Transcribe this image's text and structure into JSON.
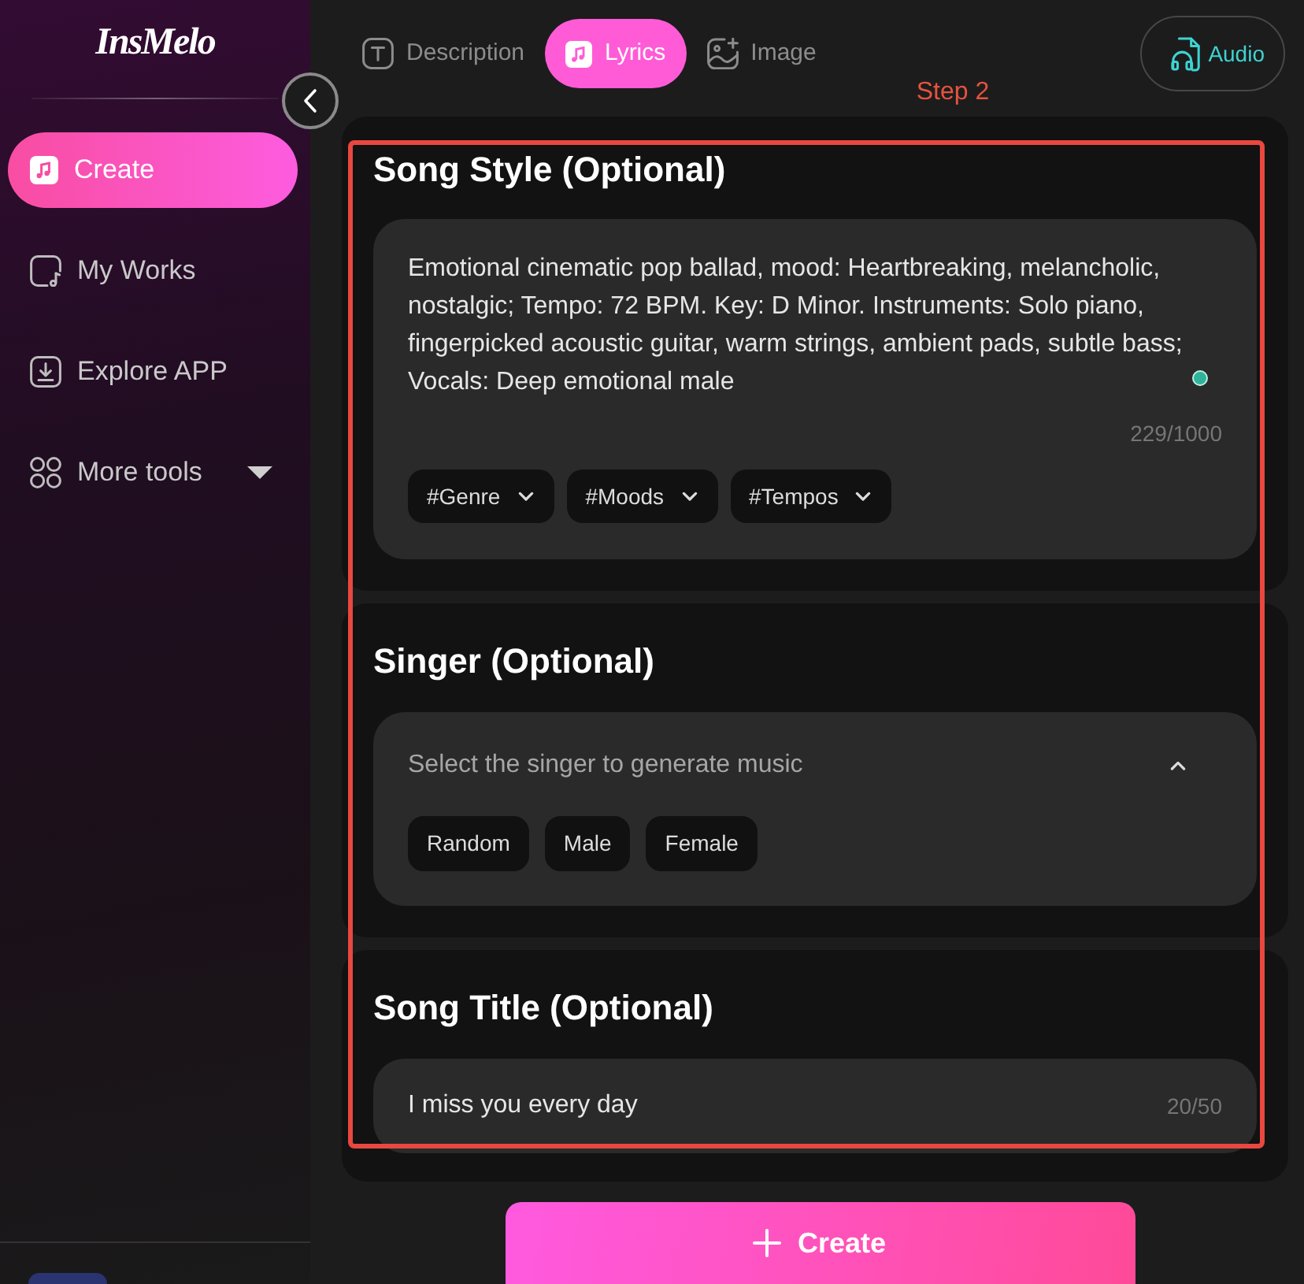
{
  "sidebar": {
    "logo": "InsMelo",
    "items": [
      {
        "label": "Create",
        "kind": "link",
        "selected": true
      },
      {
        "label": "My Works",
        "kind": "link",
        "selected": false
      },
      {
        "label": "Explore APP",
        "kind": "link",
        "selected": false
      },
      {
        "label": "More tools",
        "kind": "menu",
        "selected": false
      }
    ]
  },
  "tabs": [
    {
      "label": "Description",
      "selected": false
    },
    {
      "label": "Lyrics",
      "selected": true
    },
    {
      "label": "Image",
      "selected": false
    }
  ],
  "audio_button": "Audio",
  "annotation": {
    "label": "Step 2"
  },
  "sections": [
    {
      "kind": "textarea",
      "title": "Song Style (Optional)",
      "value": "Emotional cinematic pop ballad, mood: Heartbreaking, melancholic, nostalgic; Tempo: 72 BPM. Key: D Minor. Instruments: Solo piano, fingerpicked acoustic guitar, warm strings, ambient pads, subtle bass; Vocals: Deep emotional male",
      "counter": "229/1000",
      "tags": [
        "#Genre",
        "#Moods",
        "#Tempos"
      ]
    },
    {
      "kind": "select",
      "title": "Singer (Optional)",
      "placeholder": "Select the singer to generate music",
      "expanded": true,
      "options": [
        {
          "label": "Random",
          "selected": false
        },
        {
          "label": "Male",
          "selected": false
        },
        {
          "label": "Female",
          "selected": false
        }
      ]
    },
    {
      "kind": "input",
      "title": "Song Title (Optional)",
      "value": "I miss you every day",
      "counter": "20/50"
    }
  ],
  "create_button": "Create"
}
